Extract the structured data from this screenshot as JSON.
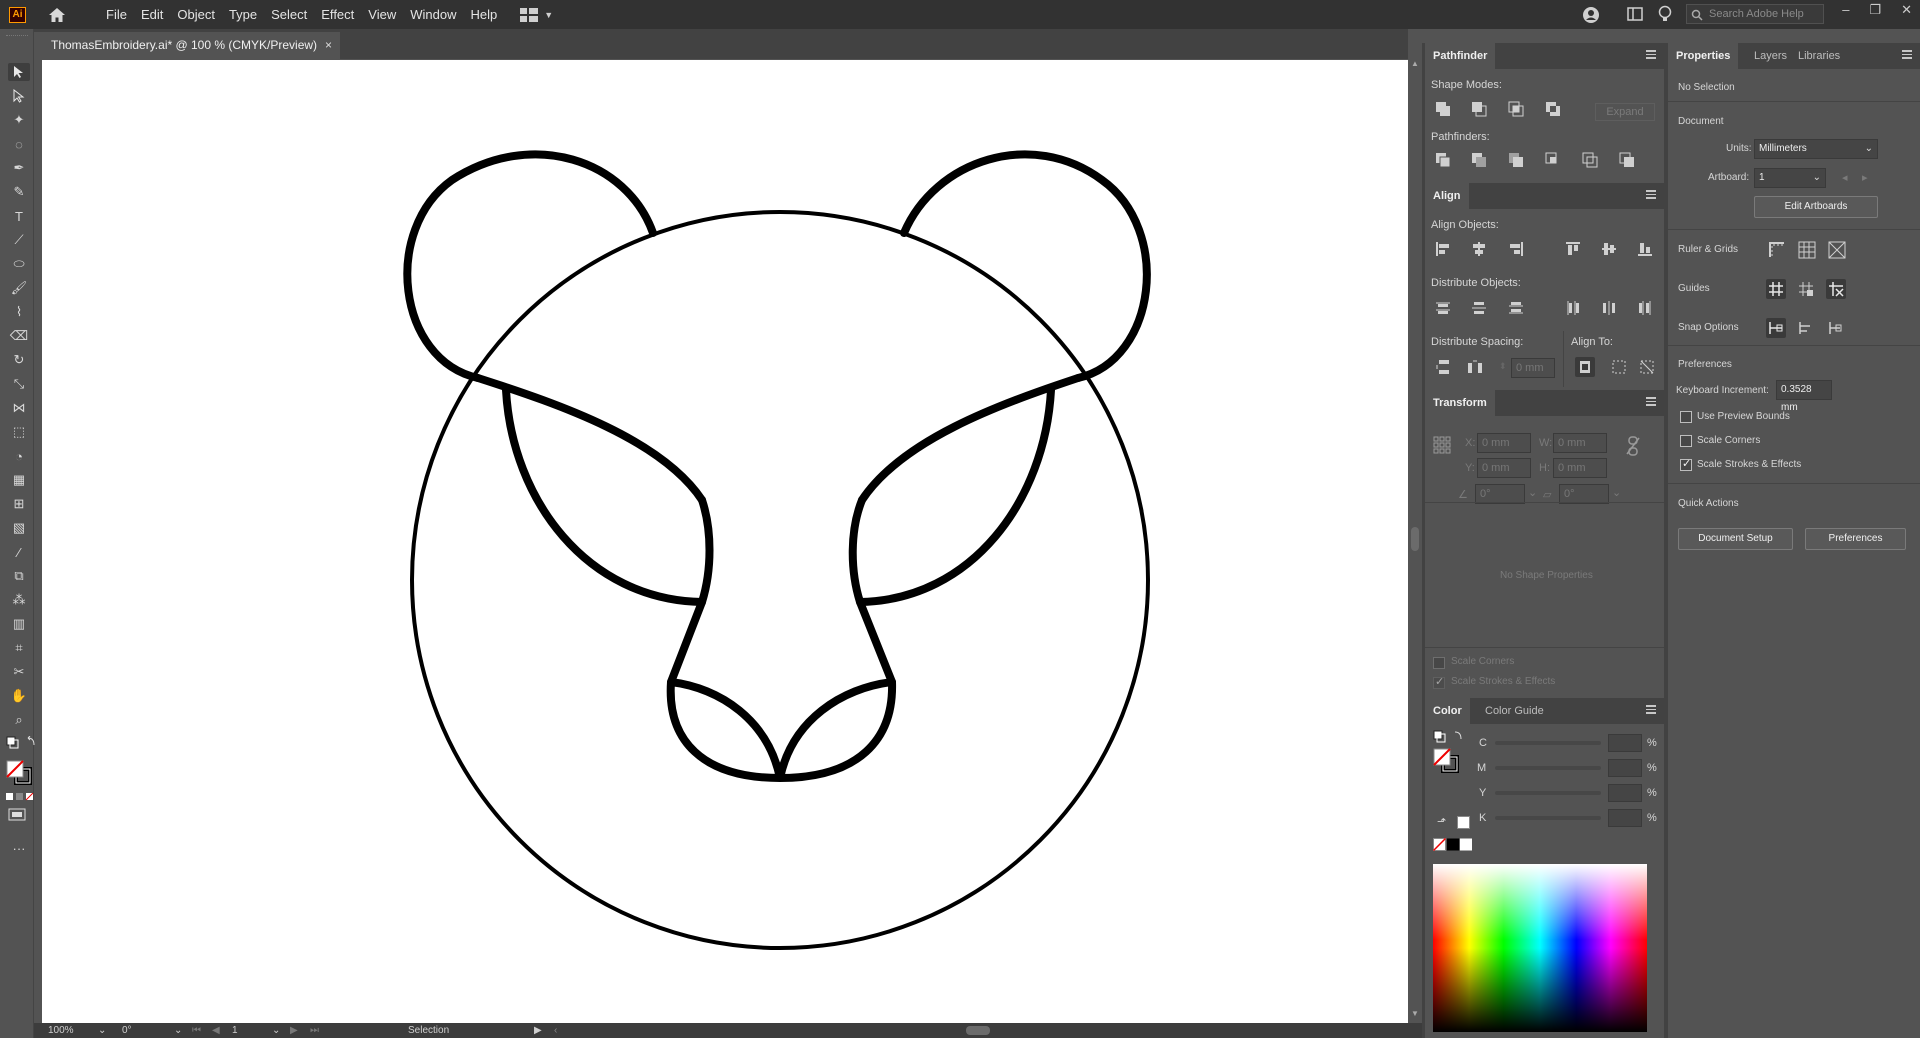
{
  "app": {
    "logo": "Ai",
    "search_placeholder": "Search Adobe Help"
  },
  "menu": [
    "File",
    "Edit",
    "Object",
    "Type",
    "Select",
    "Effect",
    "View",
    "Window",
    "Help"
  ],
  "document": {
    "tab_title": "ThomasEmbroidery.ai* @ 100 % (CMYK/Preview)",
    "close": "×"
  },
  "status": {
    "zoom": "100%",
    "rotation": "0°",
    "artboard": "1",
    "tool": "Selection"
  },
  "pathfinder": {
    "tab": "Pathfinder",
    "shape_modes_label": "Shape Modes:",
    "expand_label": "Expand",
    "pathfinders_label": "Pathfinders:"
  },
  "align": {
    "tab": "Align",
    "align_objects_label": "Align Objects:",
    "distribute_objects_label": "Distribute Objects:",
    "distribute_spacing_label": "Distribute Spacing:",
    "align_to_label": "Align To:",
    "spacing_value": "0 mm"
  },
  "transform": {
    "tab": "Transform",
    "x_label": "X:",
    "x_value": "0 mm",
    "y_label": "Y:",
    "y_value": "0 mm",
    "w_label": "W:",
    "w_value": "0 mm",
    "h_label": "H:",
    "h_value": "0 mm",
    "angle_value": "0°",
    "shear_value": "0°",
    "no_shape": "No Shape Properties",
    "scale_corners": "Scale Corners",
    "scale_strokes": "Scale Strokes & Effects"
  },
  "color": {
    "tab": "Color",
    "guide_tab": "Color Guide",
    "channels": [
      "C",
      "M",
      "Y",
      "K"
    ],
    "percent": "%"
  },
  "properties": {
    "tabs": [
      "Properties",
      "Layers",
      "Libraries"
    ],
    "no_selection": "No Selection",
    "document_label": "Document",
    "units_label": "Units:",
    "units_value": "Millimeters",
    "artboard_label": "Artboard:",
    "artboard_value": "1",
    "edit_artboards": "Edit Artboards",
    "ruler_grids": "Ruler & Grids",
    "guides": "Guides",
    "snap_options": "Snap Options",
    "preferences_label": "Preferences",
    "keyboard_increment_label": "Keyboard Increment:",
    "keyboard_increment_value": "0.3528 mm",
    "use_preview_bounds": "Use Preview Bounds",
    "scale_corners": "Scale Corners",
    "scale_strokes": "Scale Strokes & Effects",
    "quick_actions": "Quick Actions",
    "document_setup": "Document Setup",
    "preferences_button": "Preferences"
  },
  "checkboxes": {
    "use_preview_bounds": false,
    "scale_corners": false,
    "scale_strokes": true
  },
  "colors": {
    "menubar": "#323232",
    "panel": "#535353",
    "canvas": "#ffffff",
    "stroke": "#000000",
    "logo_orange": "#ff9a00"
  }
}
